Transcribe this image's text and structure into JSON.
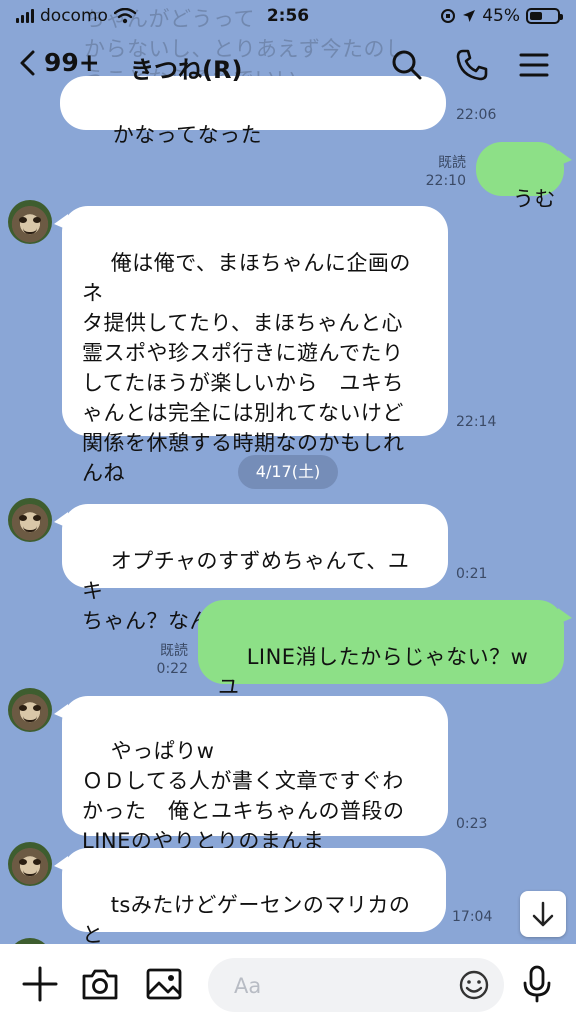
{
  "status": {
    "carrier": "docomo",
    "time": "2:56",
    "battery": "45%",
    "battery_level": 0.45
  },
  "header": {
    "back_count": "99+",
    "title": "きつね(R)"
  },
  "date_separator": "4/17(土)",
  "messages": {
    "m0": {
      "text": "かなってなった",
      "time": "22:06",
      "faded_bg_text": "ちゃんがどうって\nからないし、とりあえず今たのし\nうことならそれでいい"
    },
    "m1": {
      "text": "うむ",
      "read": "既読",
      "time": "22:10"
    },
    "m2": {
      "text": "俺は俺で、まほちゃんに企画のネ\nタ提供してたり、まほちゃんと心\n霊スポや珍スポ行きに遊んでたり\nしてたほうが楽しいから　ユキち\nゃんとは完全には別れてないけど\n関係を休憩する時期なのかもしれ\nんね",
      "time": "22:14"
    },
    "m3": {
      "text": "オプチャのすずめちゃんて、ユキ\nちゃん？なんかあったんかな",
      "time": "0:21"
    },
    "m4": {
      "text": "LINE消したからじゃない？wユ\nキちゃん確定だね！笑",
      "read": "既読",
      "time": "0:22"
    },
    "m5": {
      "text": "やっぱりw\nＯＤしてる人が書く文章ですぐわ\nかった　俺とユキちゃんの普段の\nLINEのやりとりのまんま",
      "time": "0:23"
    },
    "m6": {
      "text": "tsみたけどゲーセンのマリカのと\nき床におきっぱなしっぽい",
      "time": "17:04"
    }
  },
  "input": {
    "placeholder": "Aa",
    "value": ""
  },
  "colors": {
    "chat_bg": "#8aa6d6",
    "bubble_self": "#8de087",
    "bubble_other": "#ffffff"
  }
}
